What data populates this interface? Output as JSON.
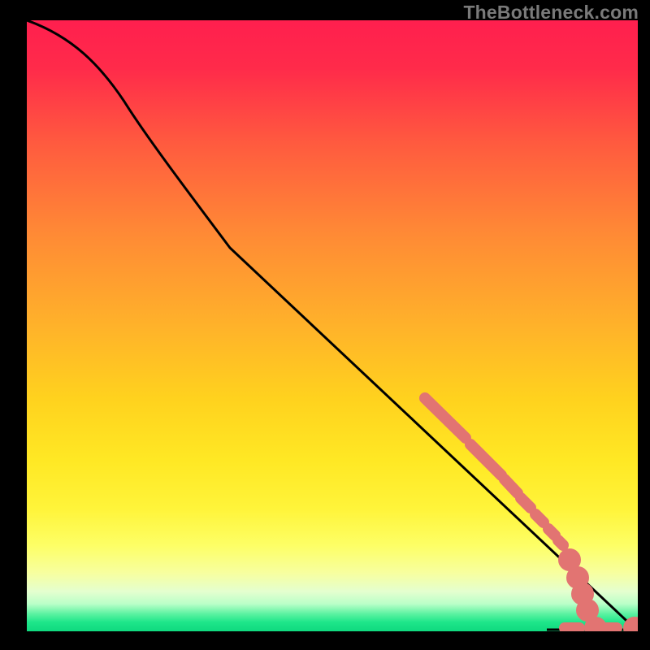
{
  "watermark": "TheBottleneck.com",
  "colors": {
    "grad_top": "#ff1f4e",
    "grad_mid": "#ffd21e",
    "grad_low": "#fff43a",
    "grad_green": "#0fd97f",
    "marker": "#e27472",
    "curve": "#000000",
    "frame": "#000000"
  },
  "chart_data": {
    "type": "line",
    "title": "",
    "xlabel": "",
    "ylabel": "",
    "xlim": [
      0,
      100
    ],
    "ylim": [
      0,
      100
    ],
    "series": [
      {
        "name": "curve",
        "x": [
          0,
          5,
          10,
          15,
          20,
          25,
          30,
          35,
          40,
          45,
          50,
          55,
          60,
          65,
          70,
          75,
          80,
          85,
          90,
          92,
          94,
          96,
          98,
          100
        ],
        "y": [
          100,
          97,
          92,
          86,
          80,
          74,
          68,
          62,
          56,
          50,
          44,
          38,
          32,
          26,
          20,
          15,
          11,
          7,
          4,
          3,
          2,
          1,
          0,
          0
        ]
      }
    ],
    "markers": {
      "name": "highlighted-segment",
      "color": "#e27472",
      "x": [
        66,
        68,
        70,
        72,
        74,
        76,
        78,
        80,
        82,
        84,
        86,
        88,
        90,
        92,
        94,
        96,
        99,
        100
      ],
      "y": [
        38,
        36,
        33,
        31,
        28,
        26,
        23,
        21,
        18,
        16,
        13,
        11,
        8,
        5,
        3,
        1,
        0,
        0
      ]
    },
    "background_gradient_stops": [
      {
        "t": 0.0,
        "color": "#ff1f4e"
      },
      {
        "t": 0.35,
        "color": "#ff8a35"
      },
      {
        "t": 0.62,
        "color": "#ffd21e"
      },
      {
        "t": 0.86,
        "color": "#fdff66"
      },
      {
        "t": 0.95,
        "color": "#baffc8"
      },
      {
        "t": 1.0,
        "color": "#0fd97f"
      }
    ]
  }
}
